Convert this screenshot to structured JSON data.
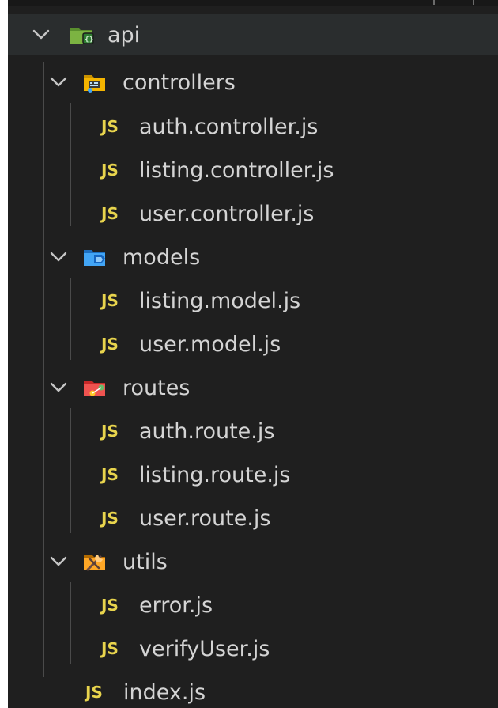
{
  "explorer": {
    "root": {
      "label": "api",
      "icon": "folder-api-icon",
      "expanded": true
    },
    "folders": [
      {
        "label": "controllers",
        "icon": "folder-controllers-icon",
        "expanded": true,
        "files": [
          {
            "label": "auth.controller.js",
            "badge": "JS"
          },
          {
            "label": "listing.controller.js",
            "badge": "JS"
          },
          {
            "label": "user.controller.js",
            "badge": "JS"
          }
        ]
      },
      {
        "label": "models",
        "icon": "folder-models-icon",
        "expanded": true,
        "files": [
          {
            "label": "listing.model.js",
            "badge": "JS"
          },
          {
            "label": "user.model.js",
            "badge": "JS"
          }
        ]
      },
      {
        "label": "routes",
        "icon": "folder-routes-icon",
        "expanded": true,
        "files": [
          {
            "label": "auth.route.js",
            "badge": "JS"
          },
          {
            "label": "listing.route.js",
            "badge": "JS"
          },
          {
            "label": "user.route.js",
            "badge": "JS"
          }
        ]
      },
      {
        "label": "utils",
        "icon": "folder-utils-icon",
        "expanded": true,
        "files": [
          {
            "label": "error.js",
            "badge": "JS"
          },
          {
            "label": "verifyUser.js",
            "badge": "JS"
          }
        ]
      }
    ],
    "root_files": [
      {
        "label": "index.js",
        "badge": "JS"
      }
    ]
  },
  "colors": {
    "background": "#1f1f1f",
    "selected_row": "#2a2d2e",
    "text": "#d4d4d4",
    "js_badge": "#e8d44d",
    "indent_guide": "#4a4a4a",
    "folder_api": "#7cb342",
    "folder_controllers": "#f4b400",
    "folder_models": "#42a5f5",
    "folder_routes": "#ef5350",
    "folder_utils": "#ffa726"
  }
}
